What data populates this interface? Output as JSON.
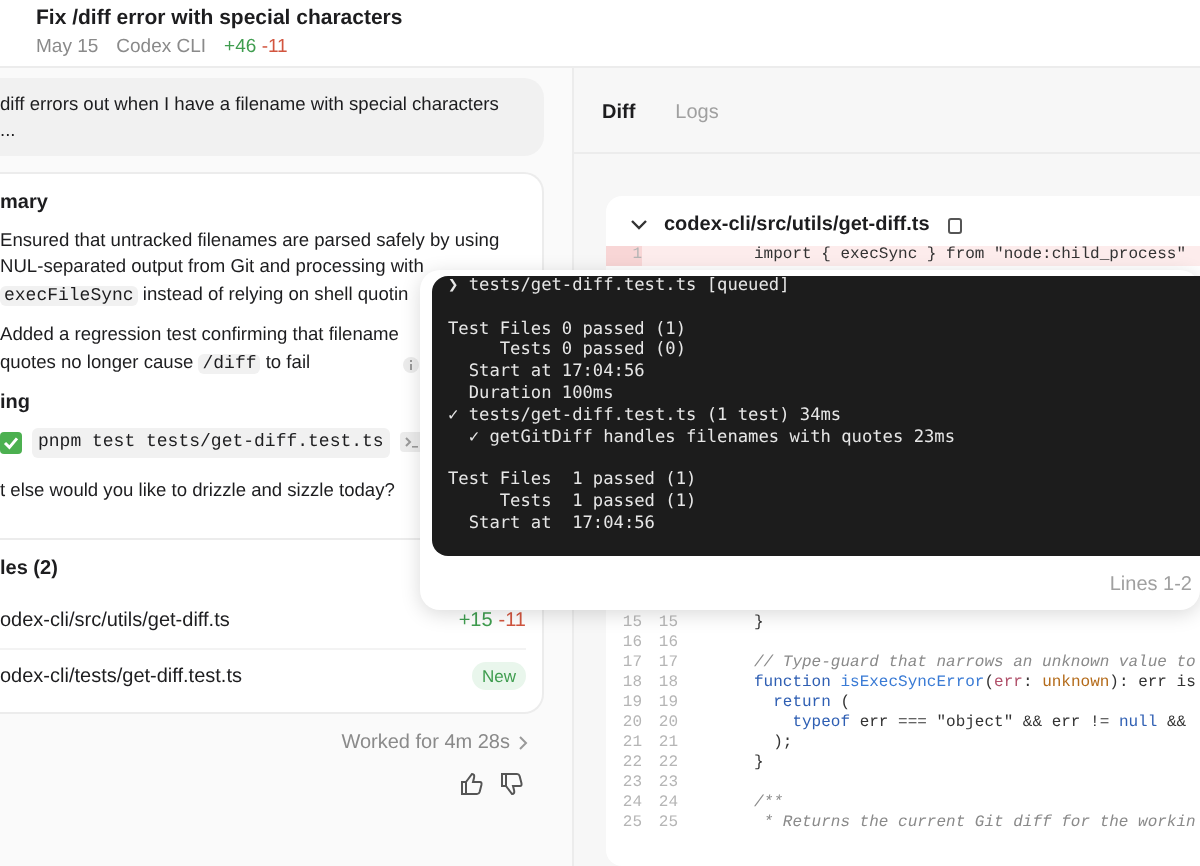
{
  "header": {
    "title": "Fix /diff error with special characters",
    "date": "May 15",
    "source": "Codex CLI",
    "added": "+46",
    "removed": "-11"
  },
  "message": {
    "lines": [
      "diff errors out when I have a filename with special characters",
      "..."
    ]
  },
  "summary": {
    "heading": "mary",
    "bullets": [
      {
        "parts": [
          {
            "kind": "text",
            "text": "Ensured that untracked filenames are parsed safely by using"
          },
          {
            "kind": "break"
          },
          {
            "kind": "text",
            "text": "NUL-separated output from Git and processing with"
          },
          {
            "kind": "break"
          },
          {
            "kind": "code",
            "text": "execFileSync"
          },
          {
            "kind": "text",
            "text": " instead of relying on shell quotin"
          }
        ],
        "info": false
      },
      {
        "parts": [
          {
            "kind": "text",
            "text": "Added a regression test confirming that filename"
          },
          {
            "kind": "break"
          },
          {
            "kind": "text",
            "text": "quotes no longer cause "
          },
          {
            "kind": "code",
            "text": "/diff"
          },
          {
            "kind": "text",
            "text": " to fail"
          }
        ],
        "info": true
      }
    ]
  },
  "testing": {
    "heading": "ing",
    "command": "pnpm test tests/get-diff.test.ts",
    "passed": true
  },
  "question": "t else would you like to drizzle and sizzle today?",
  "files": {
    "heading": "les (2)",
    "items": [
      {
        "path": "odex-cli/src/utils/get-diff.ts",
        "kind": "changes",
        "added": "+15",
        "removed": "-11"
      },
      {
        "path": "odex-cli/tests/get-diff.test.ts",
        "kind": "new",
        "badge": "New"
      }
    ]
  },
  "worked": "Worked for 4m 28s",
  "tabs": [
    {
      "label": "Diff",
      "selected": true
    },
    {
      "label": "Logs",
      "selected": false
    }
  ],
  "diff": {
    "file": "codex-cli/src/utils/get-diff.ts",
    "expanded": true,
    "rows": [
      {
        "kind": "deleted",
        "old": "1",
        "tokens": [
          {
            "kind": "plain",
            "text": "import { execSync } from \"node:child_process\""
          }
        ]
      },
      {
        "kind": "context",
        "old": "15",
        "new": "15",
        "tokens": [
          {
            "kind": "plain",
            "text": "}"
          }
        ]
      },
      {
        "kind": "context",
        "old": "16",
        "new": "16"
      },
      {
        "kind": "context",
        "old": "17",
        "new": "17",
        "tokens": [
          {
            "kind": "comment",
            "text": "// Type-guard that narrows an unknown value to"
          }
        ]
      },
      {
        "kind": "context",
        "old": "18",
        "new": "18",
        "tokens": [
          {
            "kind": "keyword",
            "text": "function "
          },
          {
            "kind": "name",
            "text": "isExecSyncError"
          },
          {
            "kind": "plain",
            "text": "("
          },
          {
            "kind": "param",
            "text": "err"
          },
          {
            "kind": "plain",
            "text": ": "
          },
          {
            "kind": "type",
            "text": "unknown"
          },
          {
            "kind": "plain",
            "text": "): err is"
          }
        ]
      },
      {
        "kind": "context",
        "old": "19",
        "new": "19",
        "tokens": [
          {
            "kind": "keyword",
            "text": "  return "
          },
          {
            "kind": "plain",
            "text": "("
          }
        ]
      },
      {
        "kind": "context",
        "old": "20",
        "new": "20",
        "tokens": [
          {
            "kind": "keyword",
            "text": "    typeof "
          },
          {
            "kind": "plain",
            "text": "err === \"object\" && err != "
          },
          {
            "kind": "keyword",
            "text": "null"
          },
          {
            "kind": "plain",
            "text": " &&"
          }
        ]
      },
      {
        "kind": "context",
        "old": "21",
        "new": "21",
        "tokens": [
          {
            "kind": "plain",
            "text": "  );"
          }
        ]
      },
      {
        "kind": "context",
        "old": "22",
        "new": "22",
        "tokens": [
          {
            "kind": "plain",
            "text": "}"
          }
        ]
      },
      {
        "kind": "context",
        "old": "23",
        "new": "23"
      },
      {
        "kind": "context",
        "old": "24",
        "new": "24",
        "tokens": [
          {
            "kind": "comment",
            "text": "/**"
          }
        ]
      },
      {
        "kind": "context",
        "old": "25",
        "new": "25",
        "tokens": [
          {
            "kind": "comment",
            "text": " * Returns the current Git diff for the workin"
          }
        ]
      }
    ]
  },
  "terminal": {
    "blocks": [
      [
        "❯ tests/get-diff.test.ts [queued]"
      ],
      [
        "Test Files 0 passed (1)",
        "     Tests 0 passed (0)",
        "  Start at 17:04:56",
        "  Duration 100ms",
        "✓ tests/get-diff.test.ts (1 test) 34ms",
        "  ✓ getGitDiff handles filenames with quotes 23ms"
      ],
      [
        "Test Files  1 passed (1)",
        "     Tests  1 passed (1)",
        "  Start at  17:04:56"
      ]
    ],
    "footer": "Lines 1-2"
  }
}
